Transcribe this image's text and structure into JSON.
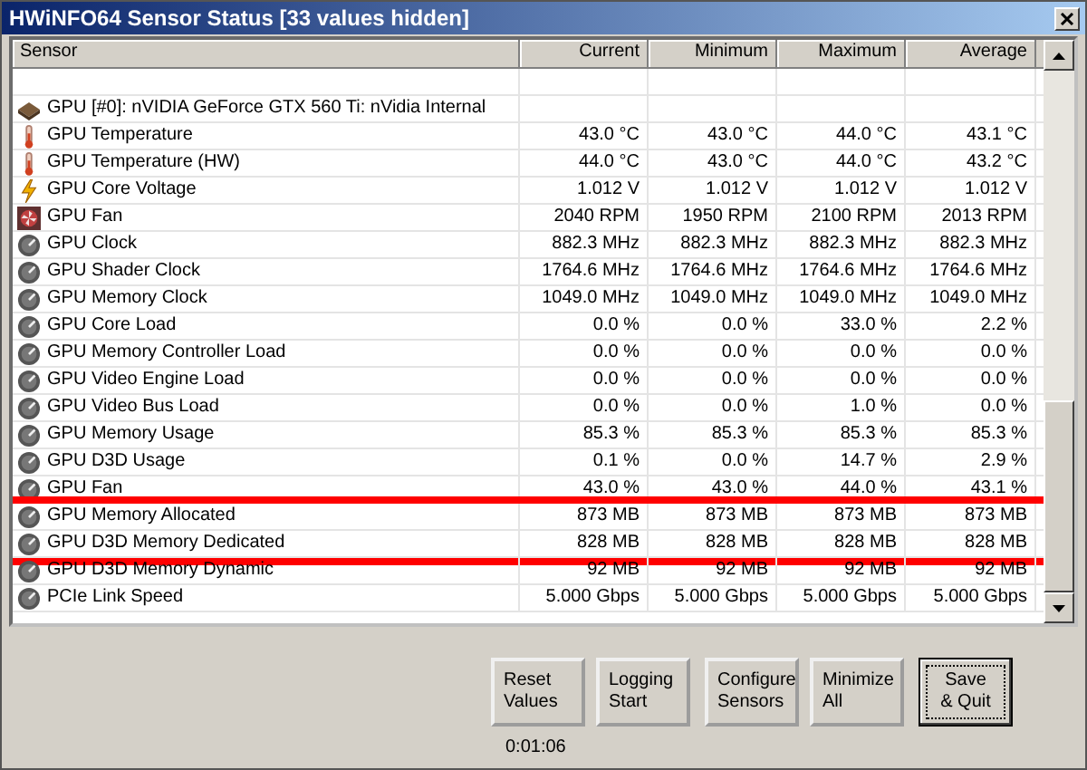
{
  "window": {
    "title": "HWiNFO64 Sensor Status [33 values hidden]"
  },
  "table": {
    "columns": [
      "Sensor",
      "Current",
      "Minimum",
      "Maximum",
      "Average"
    ],
    "rows": [
      {
        "kind": "blank",
        "label": "",
        "values": [],
        "highlighted": false
      },
      {
        "kind": "device",
        "label": "GPU [#0]: nVIDIA GeForce GTX 560 Ti: nVidia Internal",
        "values": [],
        "highlighted": false
      },
      {
        "kind": "temperature",
        "label": "GPU Temperature",
        "values": [
          "43.0 °C",
          "43.0 °C",
          "44.0 °C",
          "43.1 °C"
        ],
        "highlighted": false
      },
      {
        "kind": "temperature",
        "label": "GPU Temperature (HW)",
        "values": [
          "44.0 °C",
          "43.0 °C",
          "44.0 °C",
          "43.2 °C"
        ],
        "highlighted": false
      },
      {
        "kind": "voltage",
        "label": "GPU Core Voltage",
        "values": [
          "1.012 V",
          "1.012 V",
          "1.012 V",
          "1.012 V"
        ],
        "highlighted": false
      },
      {
        "kind": "fan",
        "label": "GPU Fan",
        "values": [
          "2040 RPM",
          "1950 RPM",
          "2100 RPM",
          "2013 RPM"
        ],
        "highlighted": false
      },
      {
        "kind": "gauge",
        "label": "GPU Clock",
        "values": [
          "882.3 MHz",
          "882.3 MHz",
          "882.3 MHz",
          "882.3 MHz"
        ],
        "highlighted": false
      },
      {
        "kind": "gauge",
        "label": "GPU Shader Clock",
        "values": [
          "1764.6 MHz",
          "1764.6 MHz",
          "1764.6 MHz",
          "1764.6 MHz"
        ],
        "highlighted": false
      },
      {
        "kind": "gauge",
        "label": "GPU Memory Clock",
        "values": [
          "1049.0 MHz",
          "1049.0 MHz",
          "1049.0 MHz",
          "1049.0 MHz"
        ],
        "highlighted": false
      },
      {
        "kind": "gauge",
        "label": "GPU Core Load",
        "values": [
          "0.0 %",
          "0.0 %",
          "33.0 %",
          "2.2 %"
        ],
        "highlighted": false
      },
      {
        "kind": "gauge",
        "label": "GPU Memory Controller Load",
        "values": [
          "0.0 %",
          "0.0 %",
          "0.0 %",
          "0.0 %"
        ],
        "highlighted": false
      },
      {
        "kind": "gauge",
        "label": "GPU Video Engine Load",
        "values": [
          "0.0 %",
          "0.0 %",
          "0.0 %",
          "0.0 %"
        ],
        "highlighted": false
      },
      {
        "kind": "gauge",
        "label": "GPU Video Bus Load",
        "values": [
          "0.0 %",
          "0.0 %",
          "1.0 %",
          "0.0 %"
        ],
        "highlighted": false
      },
      {
        "kind": "gauge",
        "label": "GPU Memory Usage",
        "values": [
          "85.3 %",
          "85.3 %",
          "85.3 %",
          "85.3 %"
        ],
        "highlighted": false
      },
      {
        "kind": "gauge",
        "label": "GPU D3D Usage",
        "values": [
          "0.1 %",
          "0.0 %",
          "14.7 %",
          "2.9 %"
        ],
        "highlighted": false
      },
      {
        "kind": "gauge",
        "label": "GPU Fan",
        "values": [
          "43.0 %",
          "43.0 %",
          "44.0 %",
          "43.1 %"
        ],
        "highlighted": false
      },
      {
        "kind": "gauge",
        "label": "GPU Memory Allocated",
        "values": [
          "873 MB",
          "873 MB",
          "873 MB",
          "873 MB"
        ],
        "highlighted": true
      },
      {
        "kind": "gauge",
        "label": "GPU D3D Memory Dedicated",
        "values": [
          "828 MB",
          "828 MB",
          "828 MB",
          "828 MB"
        ],
        "highlighted": true
      },
      {
        "kind": "gauge",
        "label": "GPU D3D Memory Dynamic",
        "values": [
          "92 MB",
          "92 MB",
          "92 MB",
          "92 MB"
        ],
        "highlighted": false
      },
      {
        "kind": "gauge",
        "label": "PCIe Link Speed",
        "values": [
          "5.000 Gbps",
          "5.000 Gbps",
          "5.000 Gbps",
          "5.000 Gbps"
        ],
        "highlighted": false
      }
    ]
  },
  "buttons": [
    {
      "label": "Reset\nValues",
      "default": false
    },
    {
      "label": "Logging\nStart",
      "default": false
    },
    {
      "label": "Configure\nSensors",
      "default": false
    },
    {
      "label": "Minimize\nAll",
      "default": false
    },
    {
      "label": "Save\n& Quit",
      "default": true
    }
  ],
  "timer": "0:01:06"
}
